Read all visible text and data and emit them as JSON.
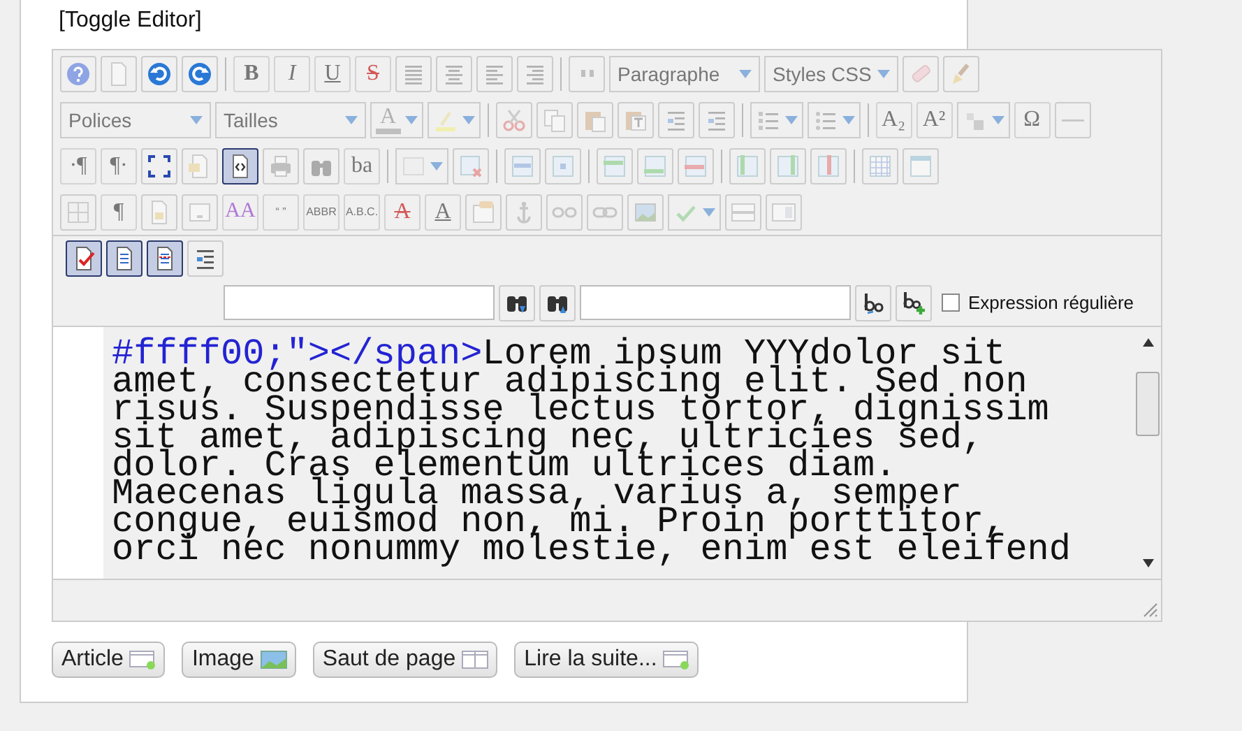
{
  "toggle_link": "[Toggle Editor]",
  "toolbars": [
    [
      {
        "kind": "button",
        "disabled": false,
        "active": false
      },
      {
        "kind": "button",
        "disabled": true,
        "active": false
      },
      {
        "kind": "button",
        "disabled": false,
        "active": false
      },
      {
        "kind": "button",
        "disabled": false,
        "active": false
      },
      {
        "kind": "separator"
      },
      {
        "kind": "glyph",
        "label": "B",
        "disabled": true,
        "active": false
      },
      {
        "kind": "glyph",
        "label": "I",
        "disabled": true,
        "active": false
      },
      {
        "kind": "glyph",
        "label": "U",
        "disabled": true,
        "active": false
      },
      {
        "kind": "glyph",
        "label": "S",
        "disabled": true,
        "active": false
      },
      {
        "kind": "button",
        "disabled": true,
        "active": false
      },
      {
        "kind": "button",
        "disabled": true,
        "active": false
      },
      {
        "kind": "button",
        "disabled": true,
        "active": false
      },
      {
        "kind": "button",
        "disabled": true,
        "active": false
      },
      {
        "kind": "separator"
      },
      {
        "kind": "button",
        "disabled": true,
        "active": false
      },
      {
        "kind": "select",
        "label": "Paragraphe",
        "disabled": true
      },
      {
        "kind": "select",
        "label": "Styles CSS",
        "disabled": true
      },
      {
        "kind": "button",
        "disabled": true,
        "active": false
      },
      {
        "kind": "button",
        "disabled": true,
        "active": false
      }
    ],
    [
      {
        "kind": "select",
        "label": "Polices",
        "disabled": true
      },
      {
        "kind": "select",
        "label": "Tailles",
        "disabled": true
      },
      {
        "kind": "split",
        "label": "A",
        "disabled": true,
        "active": false
      },
      {
        "kind": "split",
        "disabled": true,
        "active": false
      },
      {
        "kind": "separator"
      },
      {
        "kind": "button",
        "disabled": true,
        "active": false
      },
      {
        "kind": "button",
        "disabled": true,
        "active": false
      },
      {
        "kind": "button",
        "disabled": true,
        "active": false
      },
      {
        "kind": "button",
        "disabled": true,
        "active": false
      },
      {
        "kind": "button",
        "disabled": true,
        "active": false
      },
      {
        "kind": "button",
        "disabled": true,
        "active": false
      },
      {
        "kind": "separator"
      },
      {
        "kind": "split",
        "disabled": true,
        "active": false
      },
      {
        "kind": "split",
        "disabled": true,
        "active": false
      },
      {
        "kind": "separator"
      },
      {
        "kind": "glyph",
        "label": "A₂",
        "disabled": true,
        "active": false
      },
      {
        "kind": "glyph",
        "label": "A²",
        "disabled": true,
        "active": false
      },
      {
        "kind": "split",
        "disabled": true,
        "active": false
      },
      {
        "kind": "glyph",
        "label": "Ω",
        "disabled": true,
        "active": false
      },
      {
        "kind": "button",
        "disabled": true,
        "active": false
      }
    ],
    [
      {
        "kind": "glyph",
        "label": "·¶",
        "disabled": true,
        "active": false
      },
      {
        "kind": "glyph",
        "label": "¶·",
        "disabled": true,
        "active": false
      },
      {
        "kind": "button",
        "disabled": false,
        "active": false
      },
      {
        "kind": "button",
        "disabled": true,
        "active": false
      },
      {
        "kind": "button",
        "disabled": false,
        "active": true
      },
      {
        "kind": "button",
        "disabled": true,
        "active": false
      },
      {
        "kind": "button",
        "disabled": true,
        "active": false
      },
      {
        "kind": "glyph",
        "label": "ba",
        "disabled": true,
        "active": false
      },
      {
        "kind": "separator"
      },
      {
        "kind": "split",
        "disabled": true,
        "active": false
      },
      {
        "kind": "button",
        "disabled": true,
        "active": false
      },
      {
        "kind": "separator"
      },
      {
        "kind": "button",
        "disabled": true,
        "active": false
      },
      {
        "kind": "button",
        "disabled": true,
        "active": false
      },
      {
        "kind": "separator"
      },
      {
        "kind": "button",
        "disabled": true,
        "active": false
      },
      {
        "kind": "button",
        "disabled": true,
        "active": false
      },
      {
        "kind": "button",
        "disabled": true,
        "active": false
      },
      {
        "kind": "separator"
      },
      {
        "kind": "button",
        "disabled": true,
        "active": false
      },
      {
        "kind": "button",
        "disabled": true,
        "active": false
      },
      {
        "kind": "button",
        "disabled": true,
        "active": false
      },
      {
        "kind": "separator"
      },
      {
        "kind": "button",
        "disabled": true,
        "active": false
      },
      {
        "kind": "button",
        "disabled": true,
        "active": false
      }
    ],
    [
      {
        "kind": "button",
        "disabled": true,
        "active": false
      },
      {
        "kind": "glyph",
        "label": "¶",
        "disabled": true,
        "active": false
      },
      {
        "kind": "button",
        "disabled": true,
        "active": false
      },
      {
        "kind": "button",
        "disabled": true,
        "active": false
      },
      {
        "kind": "glyph",
        "label": "AA",
        "disabled": true,
        "active": false
      },
      {
        "kind": "glyph",
        "label": "“ ”",
        "disabled": true,
        "active": false
      },
      {
        "kind": "glyph",
        "label": "ABBR",
        "disabled": true,
        "active": false
      },
      {
        "kind": "glyph",
        "label": "A.B.C.",
        "disabled": true,
        "active": false
      },
      {
        "kind": "glyph",
        "label": "A",
        "disabled": true,
        "active": false
      },
      {
        "kind": "glyph",
        "label": "A",
        "disabled": true,
        "active": false
      },
      {
        "kind": "button",
        "disabled": true,
        "active": false
      },
      {
        "kind": "button",
        "disabled": true,
        "active": false
      },
      {
        "kind": "button",
        "disabled": true,
        "active": false
      },
      {
        "kind": "button",
        "disabled": true,
        "active": false
      },
      {
        "kind": "button",
        "disabled": true,
        "active": false
      },
      {
        "kind": "split",
        "disabled": true,
        "active": false
      },
      {
        "kind": "button",
        "disabled": true,
        "active": false
      },
      {
        "kind": "button",
        "disabled": true,
        "active": false
      }
    ],
    [
      {
        "kind": "button",
        "disabled": false,
        "active": true
      },
      {
        "kind": "button",
        "disabled": false,
        "active": true
      },
      {
        "kind": "button",
        "disabled": false,
        "active": true
      },
      {
        "kind": "button",
        "disabled": false,
        "active": false
      }
    ]
  ],
  "find_bar": {
    "regex": {
      "label": "Expression régulière",
      "checked": false
    }
  },
  "code_lines": [
    [
      {
        "kind": "tag",
        "text": "#ffff00;\"></span>"
      },
      {
        "kind": "text",
        "text": "Lorem ipsum YYYdolor sit"
      }
    ],
    [
      {
        "kind": "text",
        "text": "amet, consectetur adipiscing elit. Sed non"
      }
    ],
    [
      {
        "kind": "text",
        "text": "risus. Suspendisse lectus tortor, dignissim"
      }
    ],
    [
      {
        "kind": "text",
        "text": "sit amet, adipiscing nec, ultricies sed,"
      }
    ],
    [
      {
        "kind": "text",
        "text": "dolor. Cras elementum ultrices diam."
      }
    ],
    [
      {
        "kind": "text",
        "text": "Maecenas ligula massa, varius a, semper"
      }
    ],
    [
      {
        "kind": "text",
        "text": "congue, euismod non, mi. Proin porttitor,"
      }
    ],
    [
      {
        "kind": "text",
        "text": "orci nec nonummy molestie, enim est eleifend"
      }
    ]
  ],
  "buttons": [
    "Article",
    "Image",
    "Saut de page",
    "Lire la suite..."
  ]
}
